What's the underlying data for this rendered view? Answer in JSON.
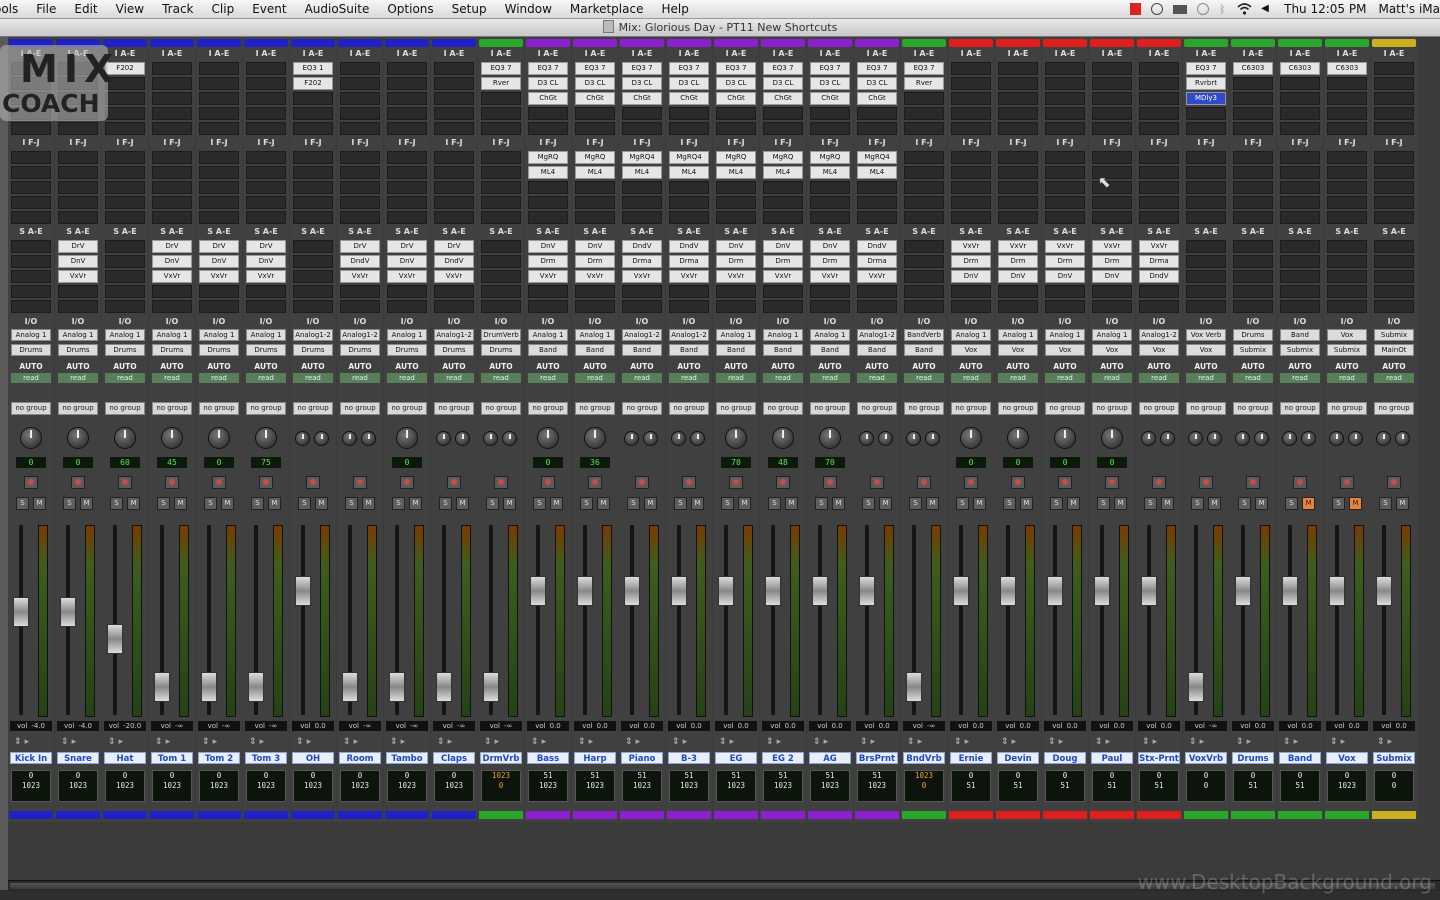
{
  "menubar": {
    "items": [
      "ools",
      "File",
      "Edit",
      "View",
      "Track",
      "Clip",
      "Event",
      "AudioSuite",
      "Options",
      "Setup",
      "Window",
      "Marketplace",
      "Help"
    ],
    "clock": "Thu 12:05 PM",
    "user": "Matt's iMa"
  },
  "window": {
    "title": "Mix: Glorious Day - PT11 New Shortcuts"
  },
  "logo": {
    "text_top": "MIX",
    "text_bottom": "COACH"
  },
  "watermark": "www.DesktopBackground.org",
  "mixer": {
    "section_labels": {
      "inserts_ae": "I A-E",
      "inserts_fj": "I F-J",
      "sends_ae": "S A-E",
      "io": "I/O",
      "auto": "AUTO",
      "auto_mode": "read",
      "group": "no group",
      "vol_prefix": "vol",
      "solo": "S",
      "mute": "M"
    },
    "tracks": [
      {
        "name": "Kick In",
        "color": "#2020c8",
        "inserts": [],
        "inserts2": [],
        "sends": [],
        "input": "Analog 1",
        "output": "Drums",
        "pan": "0",
        "vol": "-4.0",
        "fader": 0.55,
        "bottom": [
          "0",
          "1023"
        ],
        "bottom_hi": false
      },
      {
        "name": "Snare",
        "color": "#2020c8",
        "inserts": [],
        "inserts2": [],
        "sends": [
          "DrV",
          "DnV",
          "VxVr"
        ],
        "input": "Analog 1",
        "output": "Drums",
        "pan": "0",
        "vol": "-4.0",
        "fader": 0.55,
        "bottom": [
          "0",
          "1023"
        ],
        "bottom_hi": false
      },
      {
        "name": "Hat",
        "color": "#2020c8",
        "inserts": [
          "F202"
        ],
        "inserts2": [],
        "sends": [],
        "input": "Analog 1",
        "output": "Drums",
        "pan": "60",
        "vol": "-20.0",
        "fader": 0.38,
        "bottom": [
          "0",
          "1023"
        ],
        "bottom_hi": false
      },
      {
        "name": "Tom 1",
        "color": "#2020c8",
        "inserts": [],
        "inserts2": [],
        "sends": [
          "DrV",
          "DnV",
          "VxVr"
        ],
        "input": "Analog 1",
        "output": "Drums",
        "pan": "45",
        "vol": "-∞",
        "fader": 0.08,
        "bottom": [
          "0",
          "1023"
        ],
        "bottom_hi": false
      },
      {
        "name": "Tom 2",
        "color": "#2020c8",
        "inserts": [],
        "inserts2": [],
        "sends": [
          "DrV",
          "DnV",
          "VxVr"
        ],
        "input": "Analog 1",
        "output": "Drums",
        "pan": "0",
        "vol": "-∞",
        "fader": 0.08,
        "bottom": [
          "0",
          "1023"
        ],
        "bottom_hi": false
      },
      {
        "name": "Tom 3",
        "color": "#2020c8",
        "inserts": [],
        "inserts2": [],
        "sends": [
          "DrV",
          "DnV",
          "VxVr"
        ],
        "input": "Analog 1",
        "output": "Drums",
        "pan": "75",
        "vol": "-∞",
        "fader": 0.08,
        "bottom": [
          "0",
          "1023"
        ],
        "bottom_hi": false
      },
      {
        "name": "OH",
        "color": "#2020c8",
        "inserts": [
          "EQ3 1",
          "F202"
        ],
        "inserts2": [],
        "sends": [],
        "input": "Analog1-2",
        "output": "Drums",
        "pan": "",
        "vol": "0.0",
        "fader": 0.68,
        "bottom": [
          "0",
          "1023"
        ],
        "bottom_hi": false
      },
      {
        "name": "Room",
        "color": "#2020c8",
        "inserts": [],
        "inserts2": [],
        "sends": [
          "DrV",
          "DndV",
          "VxVr"
        ],
        "input": "Analog1-2",
        "output": "Drums",
        "pan": "",
        "vol": "-∞",
        "fader": 0.08,
        "bottom": [
          "0",
          "1023"
        ],
        "bottom_hi": false
      },
      {
        "name": "Tambo",
        "color": "#2020c8",
        "inserts": [],
        "inserts2": [],
        "sends": [
          "DrV",
          "DnV",
          "VxVr"
        ],
        "input": "Analog 1",
        "output": "Drums",
        "pan": "0",
        "vol": "-∞",
        "fader": 0.08,
        "bottom": [
          "0",
          "1023"
        ],
        "bottom_hi": false
      },
      {
        "name": "Claps",
        "color": "#2020c8",
        "inserts": [],
        "inserts2": [],
        "sends": [
          "DrV",
          "DndV",
          "VxVr"
        ],
        "input": "Analog1-2",
        "output": "Drums",
        "pan": "",
        "vol": "-∞",
        "fader": 0.08,
        "bottom": [
          "0",
          "1023"
        ],
        "bottom_hi": false
      },
      {
        "name": "DrmVrb",
        "color": "#2aa62a",
        "inserts": [
          "EQ3 7",
          "Rver"
        ],
        "inserts2": [],
        "sends": [],
        "input": "DrumVerb",
        "output": "Drums",
        "pan": "",
        "vol": "-∞",
        "fader": 0.08,
        "bottom": [
          "1023",
          "0"
        ],
        "bottom_hi": true
      },
      {
        "name": "Bass",
        "color": "#8c1fcf",
        "inserts": [
          "EQ3 7",
          "D3 CL",
          "ChGt"
        ],
        "inserts2": [
          "MgRQ",
          "ML4"
        ],
        "sends": [
          "DnV",
          "Drm",
          "VxVr"
        ],
        "input": "Analog 1",
        "output": "Band",
        "pan": "0",
        "vol": "0.0",
        "fader": 0.68,
        "bottom": [
          "51",
          "1023"
        ],
        "bottom_hi": false
      },
      {
        "name": "Harp",
        "color": "#8c1fcf",
        "inserts": [
          "EQ3 7",
          "D3 CL",
          "ChGt"
        ],
        "inserts2": [
          "MgRQ",
          "ML4"
        ],
        "sends": [
          "DnV",
          "Drm",
          "VxVr"
        ],
        "input": "Analog 1",
        "output": "Band",
        "pan": "36",
        "vol": "0.0",
        "fader": 0.68,
        "bottom": [
          "51",
          "1023"
        ],
        "bottom_hi": false
      },
      {
        "name": "Piano",
        "color": "#8c1fcf",
        "inserts": [
          "EQ3 7",
          "D3 CL",
          "ChGt"
        ],
        "inserts2": [
          "MgRQ4",
          "ML4"
        ],
        "sends": [
          "DndV",
          "Drma",
          "VxVr"
        ],
        "input": "Analog1-2",
        "output": "Band",
        "pan": "",
        "vol": "0.0",
        "fader": 0.68,
        "bottom": [
          "51",
          "1023"
        ],
        "bottom_hi": false
      },
      {
        "name": "B-3",
        "color": "#8c1fcf",
        "inserts": [
          "EQ3 7",
          "D3 CL",
          "ChGt"
        ],
        "inserts2": [
          "MgRQ4",
          "ML4"
        ],
        "sends": [
          "DndV",
          "Drma",
          "VxVr"
        ],
        "input": "Analog1-2",
        "output": "Band",
        "pan": "",
        "vol": "0.0",
        "fader": 0.68,
        "bottom": [
          "51",
          "1023"
        ],
        "bottom_hi": false
      },
      {
        "name": "EG",
        "color": "#8c1fcf",
        "inserts": [
          "EQ3 7",
          "D3 CL",
          "ChGt"
        ],
        "inserts2": [
          "MgRQ",
          "ML4"
        ],
        "sends": [
          "DnV",
          "Drm",
          "VxVr"
        ],
        "input": "Analog 1",
        "output": "Band",
        "pan": "70",
        "vol": "0.0",
        "fader": 0.68,
        "bottom": [
          "51",
          "1023"
        ],
        "bottom_hi": false
      },
      {
        "name": "EG 2",
        "color": "#8c1fcf",
        "inserts": [
          "EQ3 7",
          "D3 CL",
          "ChGt"
        ],
        "inserts2": [
          "MgRQ",
          "ML4"
        ],
        "sends": [
          "DnV",
          "Drm",
          "VxVr"
        ],
        "input": "Analog 1",
        "output": "Band",
        "pan": "48",
        "vol": "0.0",
        "fader": 0.68,
        "bottom": [
          "51",
          "1023"
        ],
        "bottom_hi": false
      },
      {
        "name": "AG",
        "color": "#8c1fcf",
        "inserts": [
          "EQ3 7",
          "D3 CL",
          "ChGt"
        ],
        "inserts2": [
          "MgRQ",
          "ML4"
        ],
        "sends": [
          "DnV",
          "Drm",
          "VxVr"
        ],
        "input": "Analog 1",
        "output": "Band",
        "pan": "70",
        "vol": "0.0",
        "fader": 0.68,
        "bottom": [
          "51",
          "1023"
        ],
        "bottom_hi": false
      },
      {
        "name": "BrsPrnt",
        "color": "#8c1fcf",
        "inserts": [
          "EQ3 7",
          "D3 CL",
          "ChGt"
        ],
        "inserts2": [
          "MgRQ4",
          "ML4"
        ],
        "sends": [
          "DndV",
          "Drma",
          "VxVr"
        ],
        "input": "Analog1-2",
        "output": "Band",
        "pan": "",
        "vol": "0.0",
        "fader": 0.68,
        "bottom": [
          "51",
          "1023"
        ],
        "bottom_hi": false
      },
      {
        "name": "BndVrb",
        "color": "#2aa62a",
        "inserts": [
          "EQ3 7",
          "Rver"
        ],
        "inserts2": [],
        "sends": [],
        "input": "BandVerb",
        "output": "Band",
        "pan": "",
        "vol": "-∞",
        "fader": 0.08,
        "bottom": [
          "1023",
          "0"
        ],
        "bottom_hi": true
      },
      {
        "name": "Ernie",
        "color": "#e01e1e",
        "inserts": [],
        "inserts2": [],
        "sends": [
          "VxVr",
          "Drm",
          "DnV"
        ],
        "input": "Analog 1",
        "output": "Vox",
        "pan": "0",
        "vol": "0.0",
        "fader": 0.68,
        "bottom": [
          "0",
          "51"
        ],
        "bottom_hi": false
      },
      {
        "name": "Devin",
        "color": "#e01e1e",
        "inserts": [],
        "inserts2": [],
        "sends": [
          "VxVr",
          "Drm",
          "DnV"
        ],
        "input": "Analog 1",
        "output": "Vox",
        "pan": "0",
        "vol": "0.0",
        "fader": 0.68,
        "bottom": [
          "0",
          "51"
        ],
        "bottom_hi": false
      },
      {
        "name": "Doug",
        "color": "#e01e1e",
        "inserts": [],
        "inserts2": [],
        "sends": [
          "VxVr",
          "Drm",
          "DnV"
        ],
        "input": "Analog 1",
        "output": "Vox",
        "pan": "0",
        "vol": "0.0",
        "fader": 0.68,
        "bottom": [
          "0",
          "51"
        ],
        "bottom_hi": false
      },
      {
        "name": "Paul",
        "color": "#e01e1e",
        "inserts": [],
        "inserts2": [],
        "sends": [
          "VxVr",
          "Drm",
          "DnV"
        ],
        "input": "Analog 1",
        "output": "Vox",
        "pan": "0",
        "vol": "0.0",
        "fader": 0.68,
        "bottom": [
          "0",
          "51"
        ],
        "bottom_hi": false
      },
      {
        "name": "Stx-Prnt",
        "color": "#e01e1e",
        "inserts": [],
        "inserts2": [],
        "sends": [
          "VxVr",
          "Drma",
          "DndV"
        ],
        "input": "Analog1-2",
        "output": "Vox",
        "pan": "",
        "vol": "0.0",
        "fader": 0.68,
        "bottom": [
          "0",
          "51"
        ],
        "bottom_hi": false
      },
      {
        "name": "VoxVrb",
        "color": "#2aa62a",
        "inserts": [
          "EQ3 7",
          "Rvrbrt",
          "MDly3"
        ],
        "inserts2": [],
        "sends": [],
        "input": "Vox Verb",
        "output": "Vox",
        "pan": "",
        "vol": "-∞",
        "fader": 0.08,
        "bottom": [
          "0",
          "0"
        ],
        "bottom_hi": false
      },
      {
        "name": "Drums",
        "color": "#2aa62a",
        "inserts": [
          "C6303"
        ],
        "inserts2": [],
        "sends": [],
        "input": "Drums",
        "output": "Submix",
        "pan": "",
        "vol": "0.0",
        "fader": 0.68,
        "bottom": [
          "0",
          "51"
        ],
        "bottom_hi": false
      },
      {
        "name": "Band",
        "color": "#2aa62a",
        "inserts": [
          "C6303"
        ],
        "inserts2": [],
        "sends": [],
        "input": "Band",
        "output": "Submix",
        "pan": "",
        "vol": "0.0",
        "fader": 0.68,
        "bottom": [
          "0",
          "51"
        ],
        "bottom_hi": false
      },
      {
        "name": "Vox",
        "color": "#2aa62a",
        "inserts": [
          "C6303"
        ],
        "inserts2": [],
        "sends": [],
        "input": "Vox",
        "output": "Submix",
        "pan": "",
        "vol": "0.0",
        "fader": 0.68,
        "bottom": [
          "0",
          "1023"
        ],
        "bottom_hi": false
      },
      {
        "name": "Submix",
        "color": "#c8b020",
        "inserts": [],
        "inserts2": [],
        "sends": [],
        "input": "Submix",
        "output": "MainOt",
        "pan": "",
        "vol": "0.0",
        "fader": 0.68,
        "bottom": [
          "0",
          "0"
        ],
        "bottom_hi": false
      }
    ]
  }
}
